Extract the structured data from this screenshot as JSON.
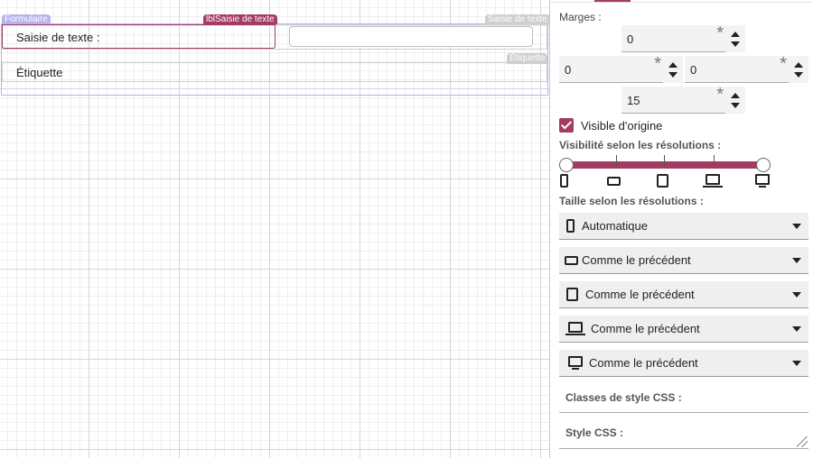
{
  "canvas": {
    "form_tag": "Formulaire",
    "label_tag": "lblSaisie de texte",
    "input_tag": "Saisie de texte",
    "etiquette_tag": "Étiquette",
    "label_text": "Saisie de texte :",
    "etiquette_text": "Étiquette"
  },
  "panel": {
    "margins_label": "Marges :",
    "margin_top": "0",
    "margin_left": "0",
    "margin_right": "0",
    "margin_bottom": "15",
    "visible_label": "Visible d'origine",
    "visible_checked": true,
    "visibility_label": "Visibilité selon les résolutions :",
    "size_label": "Taille selon les résolutions :",
    "resolutions": [
      {
        "icon": "phone-icon",
        "value": "Automatique"
      },
      {
        "icon": "tablet-landscape-icon",
        "value": "Comme le précédent"
      },
      {
        "icon": "tablet-icon",
        "value": "Comme le précédent"
      },
      {
        "icon": "laptop-icon",
        "value": "Comme le précédent"
      },
      {
        "icon": "monitor-icon",
        "value": "Comme le précédent"
      }
    ],
    "css_classes_label": "Classes de style CSS :",
    "css_style_label": "Style CSS :",
    "accent_color": "#a43b63"
  }
}
